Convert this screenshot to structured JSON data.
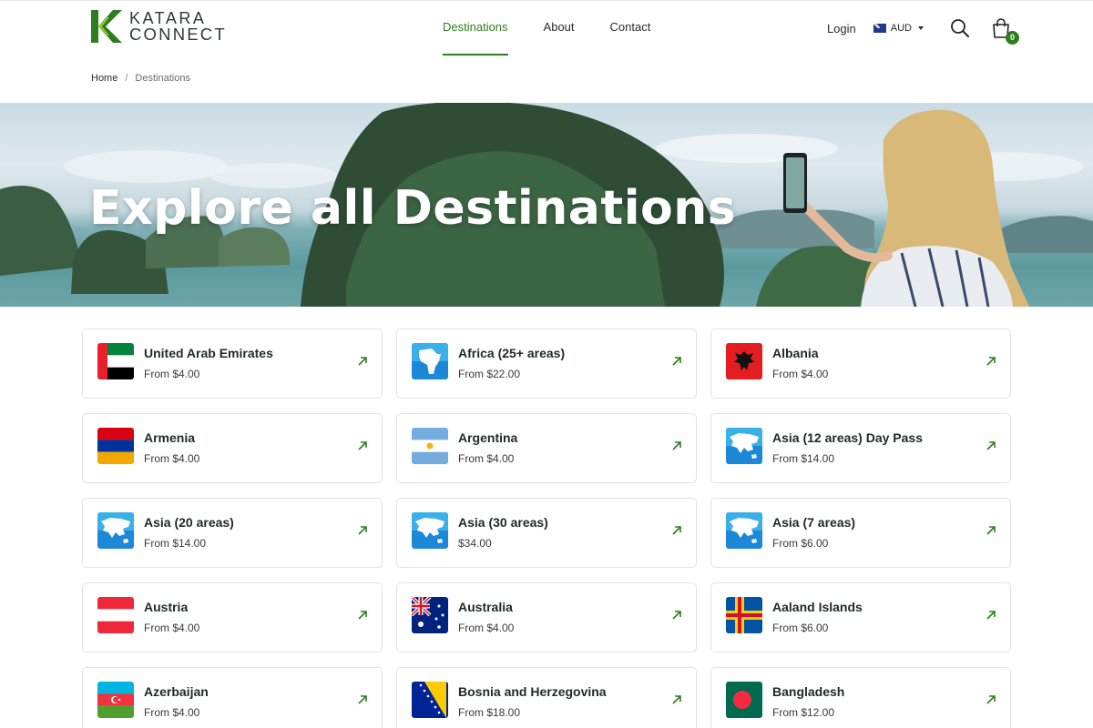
{
  "brand": {
    "line1": "KATARA",
    "line2": "CONNECT"
  },
  "nav": [
    {
      "label": "Destinations",
      "active": true
    },
    {
      "label": "About",
      "active": false
    },
    {
      "label": "Contact",
      "active": false
    }
  ],
  "header": {
    "login": "Login",
    "currency": "AUD",
    "cart_count": "0"
  },
  "breadcrumb": {
    "home": "Home",
    "separator": "/",
    "current": "Destinations"
  },
  "hero": {
    "title": "Explore all Destinations"
  },
  "accent_color": "#2f7d1f",
  "destinations": [
    {
      "name": "United Arab Emirates",
      "price": "From $4.00",
      "icon": "uae-flag"
    },
    {
      "name": "Africa (25+ areas)",
      "price": "From $22.00",
      "icon": "africa-region-icon"
    },
    {
      "name": "Albania",
      "price": "From $4.00",
      "icon": "albania-flag"
    },
    {
      "name": "Armenia",
      "price": "From $4.00",
      "icon": "armenia-flag"
    },
    {
      "name": "Argentina",
      "price": "From $4.00",
      "icon": "argentina-flag"
    },
    {
      "name": "Asia (12 areas) Day Pass",
      "price": "From $14.00",
      "icon": "asia-region-icon"
    },
    {
      "name": "Asia (20 areas)",
      "price": "From $14.00",
      "icon": "asia-region-icon"
    },
    {
      "name": "Asia (30 areas)",
      "price": "$34.00",
      "icon": "asia-region-icon"
    },
    {
      "name": "Asia (7 areas)",
      "price": "From $6.00",
      "icon": "asia-region-icon"
    },
    {
      "name": "Austria",
      "price": "From $4.00",
      "icon": "austria-flag"
    },
    {
      "name": "Australia",
      "price": "From $4.00",
      "icon": "australia-flag"
    },
    {
      "name": "Aaland Islands",
      "price": "From $6.00",
      "icon": "aaland-flag"
    },
    {
      "name": "Azerbaijan",
      "price": "From $4.00",
      "icon": "azerbaijan-flag"
    },
    {
      "name": "Bosnia and Herzegovina",
      "price": "From $18.00",
      "icon": "bosnia-flag"
    },
    {
      "name": "Bangladesh",
      "price": "From $12.00",
      "icon": "bangladesh-flag"
    }
  ]
}
